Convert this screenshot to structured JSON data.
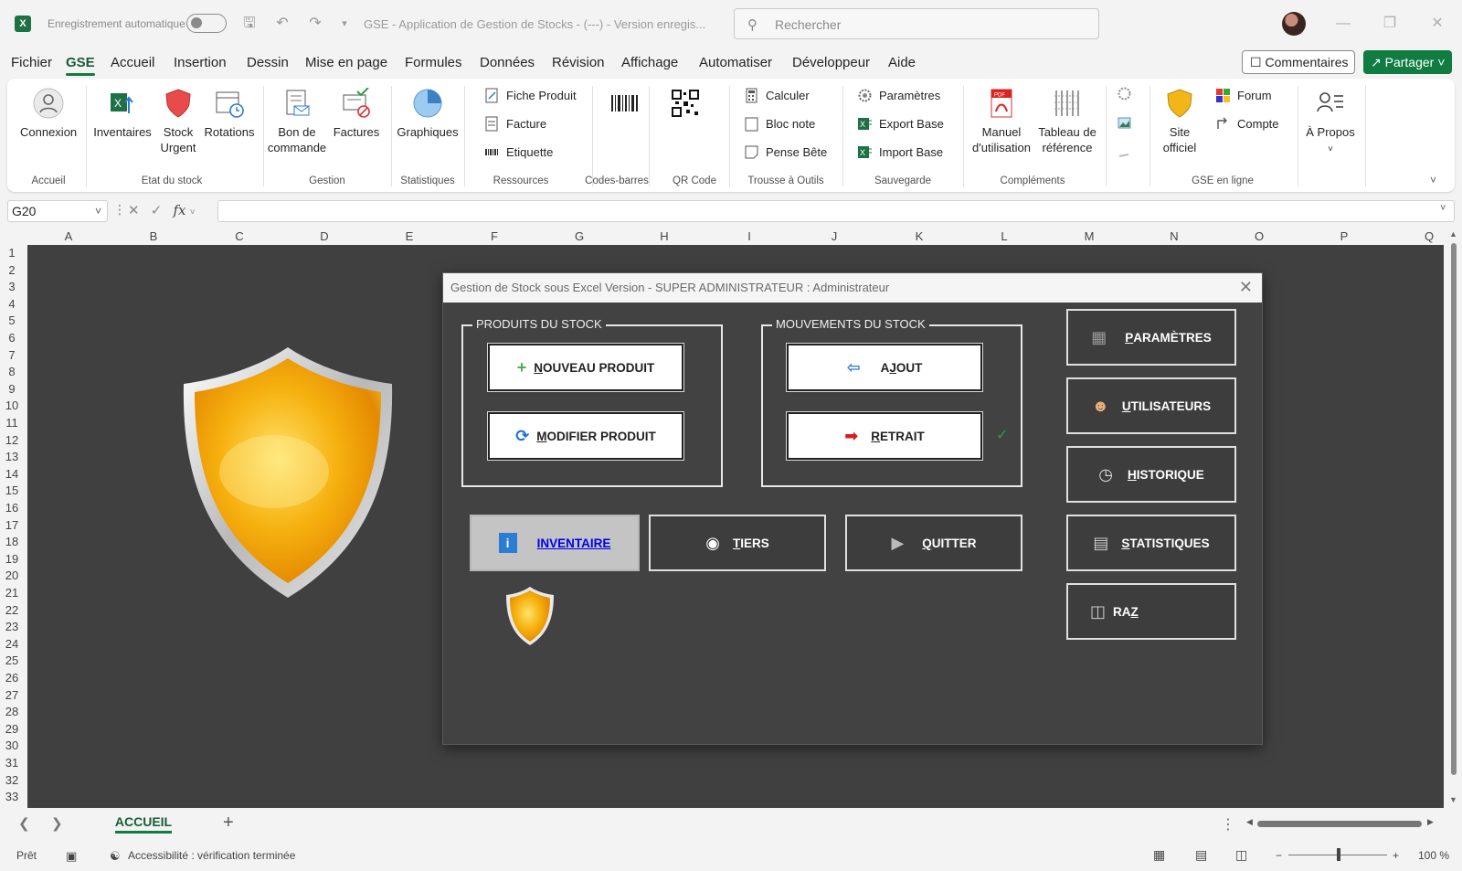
{
  "titlebar": {
    "app_logo": "X",
    "autosave_label": "Enregistrement automatique",
    "doc_title": "GSE - Application de Gestion de Stocks - (---) - Version enregis...",
    "search_placeholder": "Rechercher"
  },
  "menu": {
    "items": [
      "Fichier",
      "GSE",
      "Accueil",
      "Insertion",
      "Dessin",
      "Mise en page",
      "Formules",
      "Données",
      "Révision",
      "Affichage",
      "Automatiser",
      "Développeur",
      "Aide"
    ],
    "active": "GSE",
    "comments_label": "Commentaires",
    "share_label": "Partager"
  },
  "ribbon": {
    "connexion": "Connexion",
    "inventaires": "Inventaires",
    "stock_urgent_1": "Stock",
    "stock_urgent_2": "Urgent",
    "rotations": "Rotations",
    "bon_1": "Bon de",
    "bon_2": "commande",
    "factures": "Factures",
    "graphiques": "Graphiques",
    "fiche_produit": "Fiche Produit",
    "facture": "Facture",
    "etiquette": "Etiquette",
    "calculer": "Calculer",
    "bloc_note": "Bloc note",
    "pense_bete": "Pense Bête",
    "parametres": "Paramètres",
    "export_base": "Export Base",
    "import_base": "Import Base",
    "manuel_1": "Manuel",
    "manuel_2": "d'utilisation",
    "tableau_1": "Tableau de",
    "tableau_2": "référence",
    "site_1": "Site",
    "site_2": "officiel",
    "forum": "Forum",
    "compte": "Compte",
    "apropos": "À Propos",
    "groups": {
      "accueil": "Accueil",
      "etat": "Etat du stock",
      "gestion": "Gestion",
      "stats": "Statistiques",
      "ressources": "Ressources",
      "codes": "Codes-barres",
      "qr": "QR Code",
      "trousse": "Trousse à Outils",
      "sauvegarde": "Sauvegarde",
      "complements": "Compléments",
      "enligne": "GSE en ligne"
    }
  },
  "formula_bar": {
    "cell_ref": "G20",
    "fx": "fx",
    "value": ""
  },
  "grid": {
    "columns": [
      "A",
      "B",
      "C",
      "D",
      "E",
      "F",
      "G",
      "H",
      "I",
      "J",
      "K",
      "L",
      "M",
      "N",
      "O",
      "P",
      "Q"
    ],
    "rows": [
      "1",
      "2",
      "3",
      "4",
      "5",
      "6",
      "7",
      "8",
      "9",
      "10",
      "11",
      "12",
      "13",
      "14",
      "15",
      "16",
      "17",
      "18",
      "19",
      "20",
      "21",
      "22",
      "23",
      "24",
      "25",
      "26",
      "27",
      "28",
      "29",
      "30",
      "31",
      "32",
      "33"
    ]
  },
  "dialog": {
    "title": "Gestion de Stock sous Excel Version - SUPER ADMINISTRATEUR : Administrateur",
    "frame_produits": "PRODUITS DU STOCK",
    "frame_mouvements": "MOUVEMENTS DU STOCK",
    "btn_nouveau_u": "N",
    "btn_nouveau_rest": "OUVEAU PRODUIT",
    "btn_modifier_u": "M",
    "btn_modifier_rest": "ODIFIER PRODUIT",
    "btn_ajout_first": "A",
    "btn_ajout_u": "J",
    "btn_ajout_rest": "OUT",
    "btn_retrait_u": "R",
    "btn_retrait_rest": "ETRAIT",
    "btn_inventaire_u": "I",
    "btn_inventaire_rest": "NVENTAIRE",
    "btn_tiers_u": "T",
    "btn_tiers_rest": "IERS",
    "btn_quitter_u": "Q",
    "btn_quitter_rest": "UITTER",
    "btn_parametres_u": "P",
    "btn_parametres_rest": "ARAMÈTRES",
    "btn_utilisateurs_u": "U",
    "btn_utilisateurs_rest": "TILISATEURS",
    "btn_historique_u": "H",
    "btn_historique_rest": "ISTORIQUE",
    "btn_statistiques_u": "S",
    "btn_statistiques_rest": "TATISTIQUES",
    "btn_raz_first": "RA",
    "btn_raz_u": "Z"
  },
  "sheet_tabs": {
    "active": "ACCUEIL"
  },
  "statusbar": {
    "ready": "Prêt",
    "accessibility": "Accessibilité : vérification terminée",
    "zoom": "100 %"
  },
  "colors": {
    "accent": "#107c41",
    "sheet_bg": "#404040",
    "dialog_bg": "#424242",
    "selected_btn": "#c4c4c4"
  }
}
